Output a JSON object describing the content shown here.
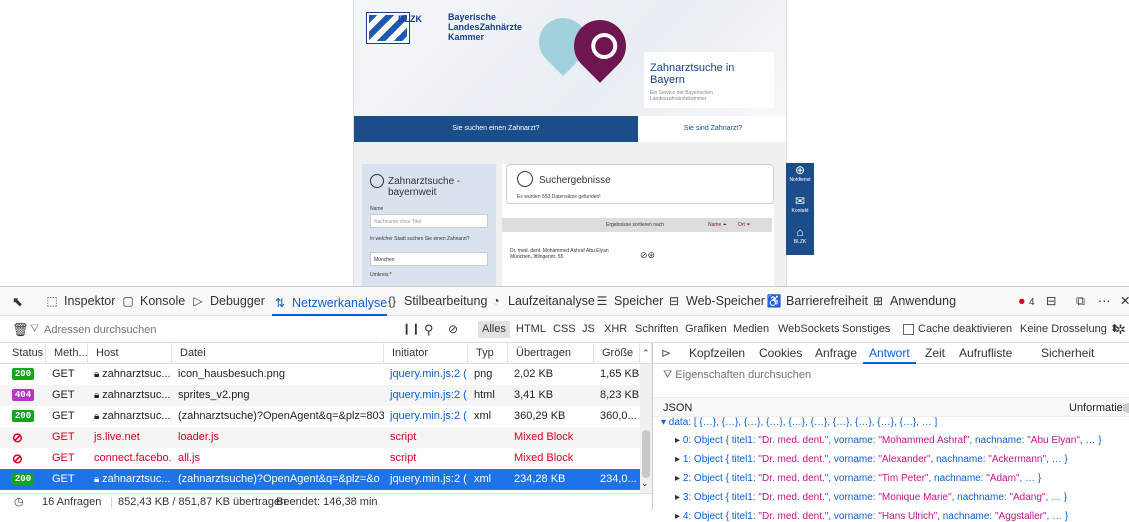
{
  "site": {
    "logo_text": "BLZK",
    "kammer_name": "Bayerische LandesZahnärzte Kammer",
    "hero_title": "Zahnarztsuche in Bayern",
    "hero_subtitle": "Ein Service der Bayerischen Landeszahnärztekammer",
    "tab_patient": "Sie suchen einen Zahnarzt?",
    "tab_dentist": "Sie sind Zahnarzt?",
    "search_title": "Zahnarztsuche - bayernweit",
    "name_label": "Name",
    "name_placeholder": "Nachname ohne Titel",
    "city_label": "In welcher Stadt suchen Sie einen Zahnarzt?",
    "city_value": "München",
    "radius_label": "Umkreis:*",
    "results_title": "Suchergebnisse",
    "results_count": "Es wurden 553 Datensätze gefunden!",
    "sort_label": "Ergebnisse sortieren nach",
    "sort_name": "Name ⏶",
    "sort_ort": "Ort ⏷",
    "result1_name": "Dr. med. dent. Mohammed Ashraf Abu Elyan",
    "result1_addr": "München, Ittlingerstr. 55",
    "side_buttons": [
      "Notdienst",
      "Kontakt",
      "BLZK"
    ]
  },
  "devtools": {
    "tabs": [
      {
        "icon": "⬚",
        "label": "Inspektor"
      },
      {
        "icon": "▢",
        "label": "Konsole"
      },
      {
        "icon": "▷",
        "label": "Debugger"
      },
      {
        "icon": "⇅",
        "label": "Netzwerkanalyse"
      },
      {
        "icon": "{}",
        "label": "Stilbearbeitung"
      },
      {
        "icon": "◔",
        "label": "Laufzeitanalyse"
      },
      {
        "icon": "☰",
        "label": "Speicher"
      },
      {
        "icon": "⊟",
        "label": "Web-Speicher"
      },
      {
        "icon": "♿",
        "label": "Barrierefreiheit"
      },
      {
        "icon": "⊞",
        "label": "Anwendung"
      }
    ],
    "error_count": "4",
    "filter_placeholder": "Adressen durchsuchen",
    "filter_types": [
      "Alles",
      "HTML",
      "CSS",
      "JS",
      "XHR",
      "Schriften",
      "Grafiken",
      "Medien",
      "WebSockets",
      "Sonstiges"
    ],
    "cache_label": "Cache deaktivieren",
    "throttle_label": "Keine Drosselung ⬍",
    "columns": [
      "Status",
      "Meth...",
      "Host",
      "Datei",
      "Initiator",
      "Typ",
      "Übertragen",
      "Größe"
    ],
    "requests": [
      {
        "status": "200",
        "method": "GET",
        "host": "zahnarztsuc...",
        "file": "icon_hausbesuch.png",
        "initiator": "jquery.min.js:2 (...",
        "type": "png",
        "transferred": "2,02 KB",
        "size": "1,65 KB"
      },
      {
        "status": "404",
        "method": "GET",
        "host": "zahnarztsuc...",
        "file": "sprites_v2.png",
        "initiator": "jquery.min.js:2 (...",
        "type": "html",
        "transferred": "3,41 KB",
        "size": "8,23 KB"
      },
      {
        "status": "200",
        "method": "GET",
        "host": "zahnarztsuc...",
        "file": "(zahnarztsuche)?OpenAgent&q=&plz=803",
        "initiator": "jquery.min.js:2 (...",
        "type": "xml",
        "transferred": "360,29 KB",
        "size": "360,0..."
      },
      {
        "status": "blocked",
        "method": "GET",
        "host": "js.live.net",
        "file": "loader.js",
        "initiator": "script",
        "type": "",
        "transferred": "Mixed Block",
        "size": ""
      },
      {
        "status": "blocked",
        "method": "GET",
        "host": "connect.facebo...",
        "file": "all.js",
        "initiator": "script",
        "type": "",
        "transferred": "Mixed Block",
        "size": ""
      },
      {
        "status": "200",
        "method": "GET",
        "host": "zahnarztsuc...",
        "file": "(zahnarztsuche)?OpenAgent&q=&plz=&o",
        "initiator": "jquery.min.js:2 (...",
        "type": "xml",
        "transferred": "234,28 KB",
        "size": "234,0..."
      }
    ],
    "status_bar": {
      "requests": "16 Anfragen",
      "transferred": "852,43 KB / 851,87 KB übertragen",
      "finished": "Beendet: 146,38 min"
    },
    "panel_tabs": [
      "Kopfzeilen",
      "Cookies",
      "Anfrage",
      "Antwort",
      "Zeit",
      "Aufrufliste",
      "Sicherheit"
    ],
    "panel_filter": "Eigenschaften durchsuchen",
    "json_label": "JSON",
    "raw_label": "Unformatiert",
    "json_root": "▾ data: [ {…}, {…}, {…}, {…}, {…}, {…}, {…}, {…}, {…}, {…}, … ]",
    "json_items": [
      {
        "idx": "0",
        "vorname": "\"Mohammed Ashraf\"",
        "nachname": "\"Abu Elyan\""
      },
      {
        "idx": "1",
        "vorname": "\"Alexander\"",
        "nachname": "\"Ackermann\""
      },
      {
        "idx": "2",
        "vorname": "\"Tim Peter\"",
        "nachname": "\"Adam\""
      },
      {
        "idx": "3",
        "vorname": "\"Monique Marie\"",
        "nachname": "\"Adang\""
      },
      {
        "idx": "4",
        "vorname": "\"Hans Ulrich\"",
        "nachname": "\"Aggstaller\""
      }
    ],
    "json_titel": "\"Dr. med. dent.\""
  },
  "colors": {
    "accent": "#0a60d6",
    "ok": "#12a51e",
    "notfound": "#b638c2",
    "blocked": "#d70022",
    "selected": "#1e73e8"
  }
}
